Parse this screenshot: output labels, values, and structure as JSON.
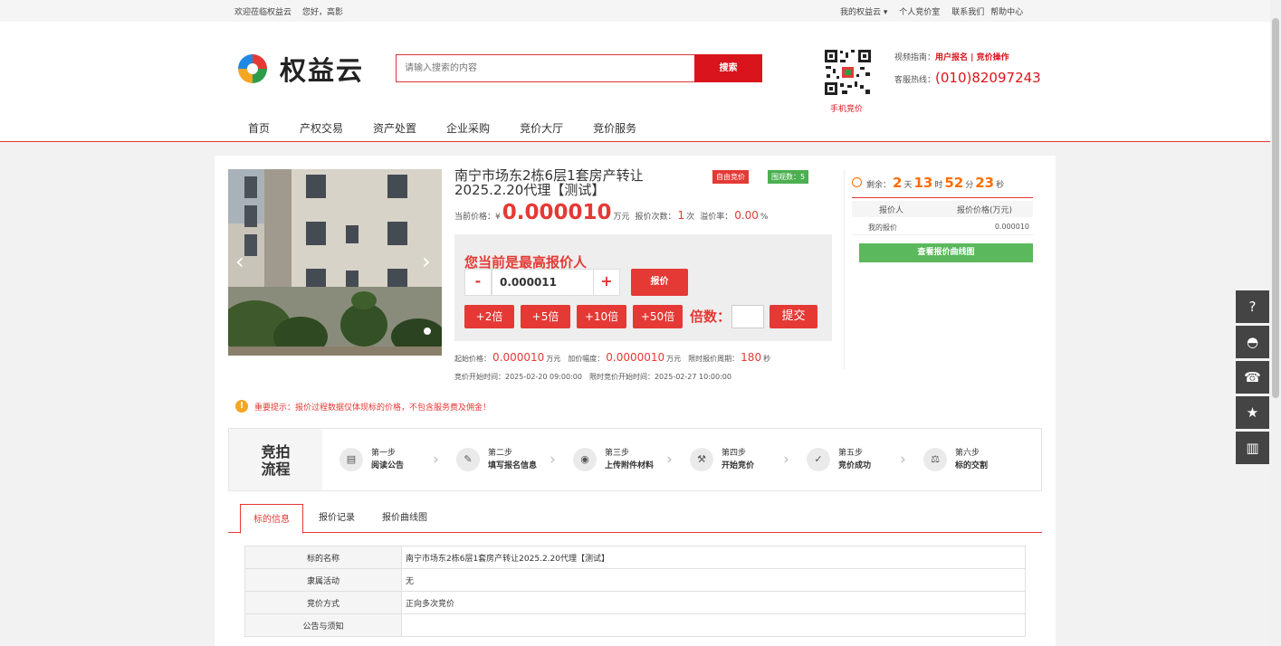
{
  "topbar": {
    "welcome": "欢迎莅临权益云",
    "hello": "您好，高影",
    "my_account": "我的权益云",
    "personal": "个人竞价室",
    "contact": "联系我们",
    "help": "帮助中心"
  },
  "header": {
    "logo_text": "权益云",
    "search_placeholder": "请输入搜索的内容",
    "search_button": "搜索",
    "qr_label": "手机竞价",
    "guide_label": "视频指南：",
    "guide_link1": "用户报名",
    "guide_sep": " | ",
    "guide_link2": "竞价操作",
    "hotline_label": "客服热线：",
    "hotline_number": "(010)82097243"
  },
  "nav": [
    "首页",
    "产权交易",
    "资产处置",
    "企业采购",
    "竞价大厅",
    "竞价服务"
  ],
  "item": {
    "title": "南宁市场东2栋6层1套房产转让2025.2.20代理【测试】",
    "tag_free": "自由竞价",
    "tag_watch": "围观数：5",
    "current_price_label": "当前价格：¥",
    "current_price": "0.000010",
    "price_unit": "万元",
    "bid_count_label": "报价次数：",
    "bid_count": "1",
    "bid_count_unit": "次",
    "premium_label": "溢价率：",
    "premium": "0.00",
    "premium_unit": "%"
  },
  "bid": {
    "highest_msg": "您当前是最高报价人",
    "minus": "-",
    "plus": "+",
    "value": "0.000011",
    "bid_button": "报价",
    "multipliers": [
      "+2倍",
      "+5倍",
      "+10倍",
      "+50倍"
    ],
    "multiple_label": "倍数：",
    "submit": "提交"
  },
  "meta": {
    "start_price_label": "起始价格：",
    "start_price": "0.000010",
    "unit": "万元",
    "increment_label": "加价幅度：",
    "increment": "0.0000010",
    "period_label": "限时报价周期：",
    "period": "180",
    "period_unit": "秒",
    "start_time": "竞价开始时间：2025-02-20 09:00:00",
    "limit_start_time": "限时竞价开始时间：2025-02-27 10:00:00"
  },
  "countdown": {
    "label": "剩余：",
    "days": "2",
    "days_unit": "天",
    "hours": "13",
    "hours_unit": "时",
    "minutes": "52",
    "minutes_unit": "分",
    "seconds": "23",
    "seconds_unit": "秒"
  },
  "bid_table": {
    "col1": "报价人",
    "col2": "报价价格(万元)",
    "row_bidder": "我的报价",
    "row_price": "0.000010",
    "curve_button": "查看报价曲线图"
  },
  "notice": "重要提示：报价过程数据仅体现标的价格，不包含服务费及佣金！",
  "flow": {
    "label_line1": "竞拍",
    "label_line2": "流程",
    "steps": [
      {
        "step": "第一步",
        "name": "阅读公告",
        "icon": "document-icon"
      },
      {
        "step": "第二步",
        "name": "填写报名信息",
        "icon": "pencil-icon"
      },
      {
        "step": "第三步",
        "name": "上传附件材料",
        "icon": "coins-icon"
      },
      {
        "step": "第四步",
        "name": "开始竞价",
        "icon": "gavel-icon"
      },
      {
        "step": "第五步",
        "name": "竞价成功",
        "icon": "check-icon"
      },
      {
        "step": "第六步",
        "name": "标的交割",
        "icon": "scale-icon"
      }
    ]
  },
  "tabs": [
    "标的信息",
    "报价记录",
    "报价曲线图"
  ],
  "info_table": [
    {
      "key": "标的名称",
      "value": "南宁市场东2栋6层1套房产转让2025.2.20代理【测试】"
    },
    {
      "key": "隶属活动",
      "value": "无"
    },
    {
      "key": "竞价方式",
      "value": "正向多次竞价"
    },
    {
      "key": "公告与须知",
      "value": ""
    }
  ],
  "float_buttons": [
    "help-icon",
    "wechat-icon",
    "phone-icon",
    "star-icon",
    "chart-icon"
  ],
  "colors": {
    "accent": "#e53935",
    "green": "#5cb85c",
    "orange": "#ff6d00"
  }
}
